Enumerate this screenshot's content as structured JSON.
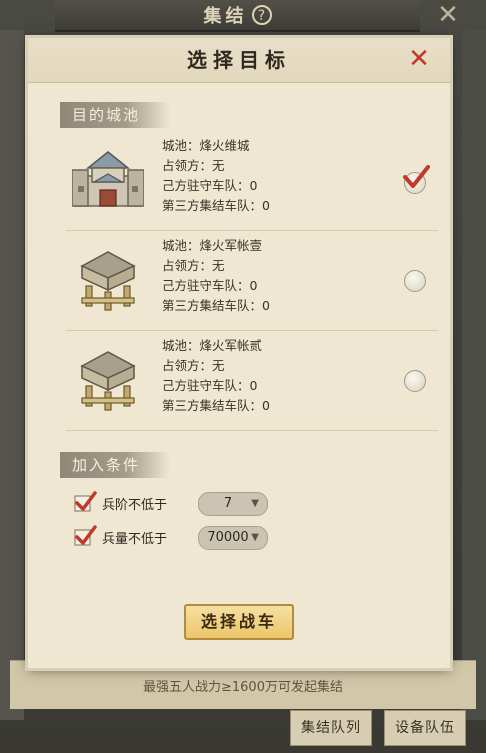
{
  "background": {
    "title": "集结",
    "note": "最强五人战力≥1600万可发起集结",
    "tabs": [
      "集结队列",
      "设备队伍"
    ]
  },
  "modal": {
    "title": "选择目标",
    "section_targets": "目的城池",
    "targets": [
      {
        "city": "城池：烽火维城",
        "occupier": "占领方：无",
        "own": "己方驻守车队：0",
        "third": "第三方集结车队：0",
        "selected": true
      },
      {
        "city": "城池：烽火军帐壹",
        "occupier": "占领方：无",
        "own": "己方驻守车队：0",
        "third": "第三方集结车队：0",
        "selected": false
      },
      {
        "city": "城池：烽火军帐贰",
        "occupier": "占领方：无",
        "own": "己方驻守车队：0",
        "third": "第三方集结车队：0",
        "selected": false
      }
    ],
    "section_conditions": "加入条件",
    "conditions": [
      {
        "label": "兵阶不低于",
        "value": "7",
        "checked": true
      },
      {
        "label": "兵量不低于",
        "value": "70000",
        "checked": true
      }
    ],
    "confirm_label": "选择战车"
  },
  "colors": {
    "accent_red": "#c0392b",
    "button_gold": "#ecc66a",
    "paper": "#efe7d2"
  }
}
